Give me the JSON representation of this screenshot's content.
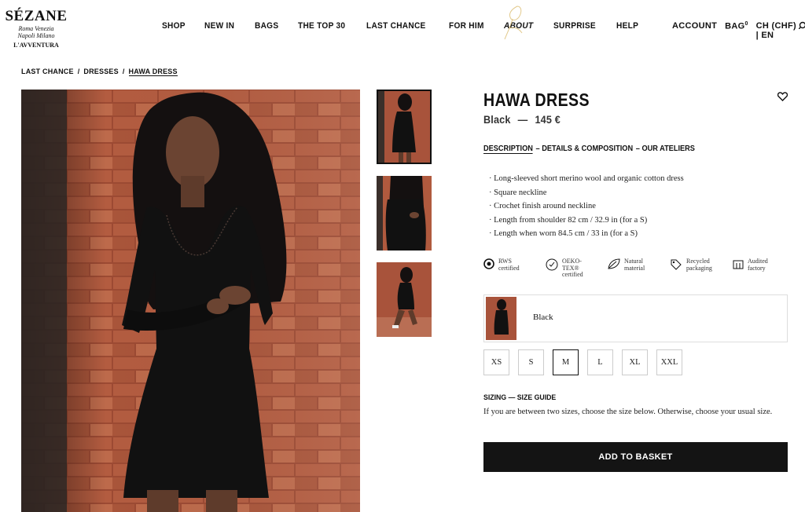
{
  "logo": {
    "brand": "SÉZANE",
    "cities_line1": "Roma  Venezia",
    "cities_line2": "Napoli  Milano",
    "sub": "L'AVVENTURA"
  },
  "nav": {
    "items": [
      "SHOP",
      "NEW IN",
      "BAGS",
      "THE TOP 30",
      "LAST CHANCE",
      "FOR HIM",
      "ABOUT",
      "SURPRISE",
      "HELP"
    ]
  },
  "account": {
    "account": "ACCOUNT",
    "bag": "BAG",
    "bag_count": "0",
    "locale": "CH (CHF) | EN"
  },
  "breadcrumb": {
    "items": [
      "LAST CHANCE",
      "DRESSES",
      "HAWA DRESS"
    ],
    "sep": "/"
  },
  "product": {
    "title": "HAWA DRESS",
    "color": "Black",
    "dash": "—",
    "price": "145 €",
    "tabs": {
      "description": "DESCRIPTION",
      "details": "– DETAILS & COMPOSITION",
      "ateliers": "– OUR ATELIERS"
    },
    "description": [
      "· Long-sleeved short merino wool and organic cotton dress",
      "· Square neckline",
      "· Crochet finish around neckline",
      "· Length from shoulder 82 cm / 32.9 in (for a S)",
      "· Length when worn 84.5 cm / 33 in (for a S)"
    ],
    "badges": [
      {
        "icon": "rws-icon",
        "l1": "RWS",
        "l2": "certified"
      },
      {
        "icon": "oeko-tex-icon",
        "l1": "OEKO-",
        "l2": "TEX®",
        "l3": "certified"
      },
      {
        "icon": "leaf-icon",
        "l1": "Natural",
        "l2": "material"
      },
      {
        "icon": "tag-icon",
        "l1": "Recycled",
        "l2": "packaging"
      },
      {
        "icon": "factory-icon",
        "l1": "Audited",
        "l2": "factory"
      }
    ],
    "color_option": "Black",
    "sizes": [
      "XS",
      "S",
      "M",
      "L",
      "XL",
      "XXL"
    ],
    "selected_size": "M",
    "sizing_label": "SIZING — SIZE GUIDE",
    "sizing_note": "If you are between two sizes, choose the size below. Otherwise, choose your usual size.",
    "basket_label": "ADD TO BASKET"
  },
  "colors": {
    "accent": "#141414",
    "brick": "#a8533b",
    "dress": "#111111"
  }
}
